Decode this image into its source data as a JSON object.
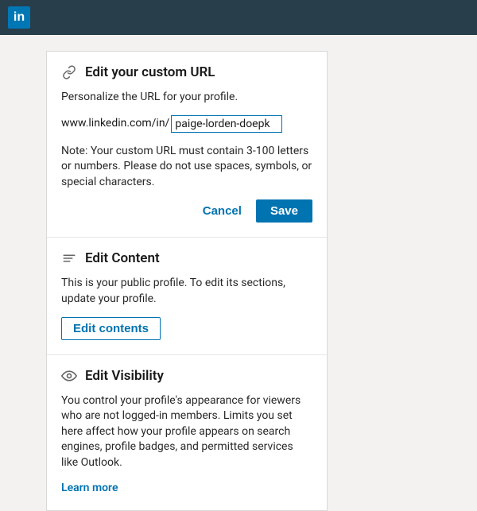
{
  "header": {
    "logo_text": "in"
  },
  "customUrl": {
    "title": "Edit your custom URL",
    "subtitle": "Personalize the URL for your profile.",
    "prefix": "www.linkedin.com/in/",
    "value": "paige-lorden-doepk",
    "note": "Note: Your custom URL must contain 3-100 letters or numbers. Please do not use spaces, symbols, or special characters.",
    "cancel_label": "Cancel",
    "save_label": "Save"
  },
  "editContent": {
    "title": "Edit Content",
    "body": "This is your public profile. To edit its sections, update your profile.",
    "button_label": "Edit contents"
  },
  "editVisibility": {
    "title": "Edit Visibility",
    "body": "You control your profile's appearance for viewers who are not logged-in members. Limits you set here affect how your profile appears on search engines, profile badges, and permitted services like Outlook.",
    "learn_more": "Learn more"
  }
}
